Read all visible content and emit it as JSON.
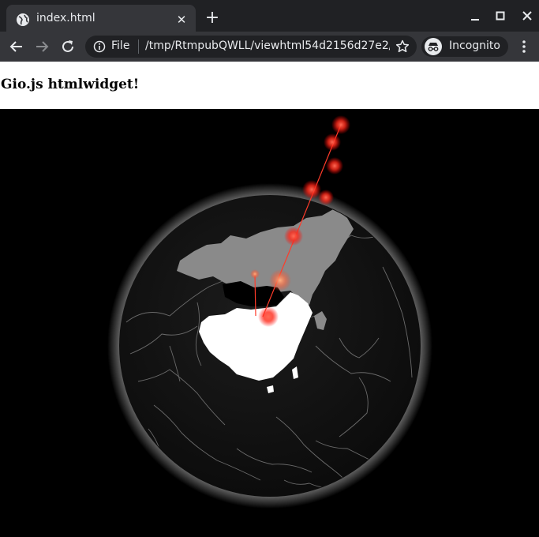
{
  "browser": {
    "tab_title": "index.html",
    "scheme_label": "File",
    "url": "/tmp/RtmpubQWLL/viewhtml54d2156d27e2/...",
    "profile_label": "Incognito"
  },
  "page": {
    "title": "Gio.js htmlwidget!"
  },
  "colors": {
    "chrome_dark": "#202124",
    "chrome_mid": "#35363a",
    "arc": "#ff3b2a",
    "highlight_country": "#ffffff",
    "related_countries": "#8a8a8a"
  },
  "icons": {
    "favicon": "globe-icon",
    "back": "arrow-left-icon",
    "forward": "arrow-right-icon",
    "reload": "reload-icon",
    "info": "info-icon",
    "bookmark": "star-icon",
    "incognito": "incognito-icon",
    "menu": "kebab-menu-icon"
  }
}
